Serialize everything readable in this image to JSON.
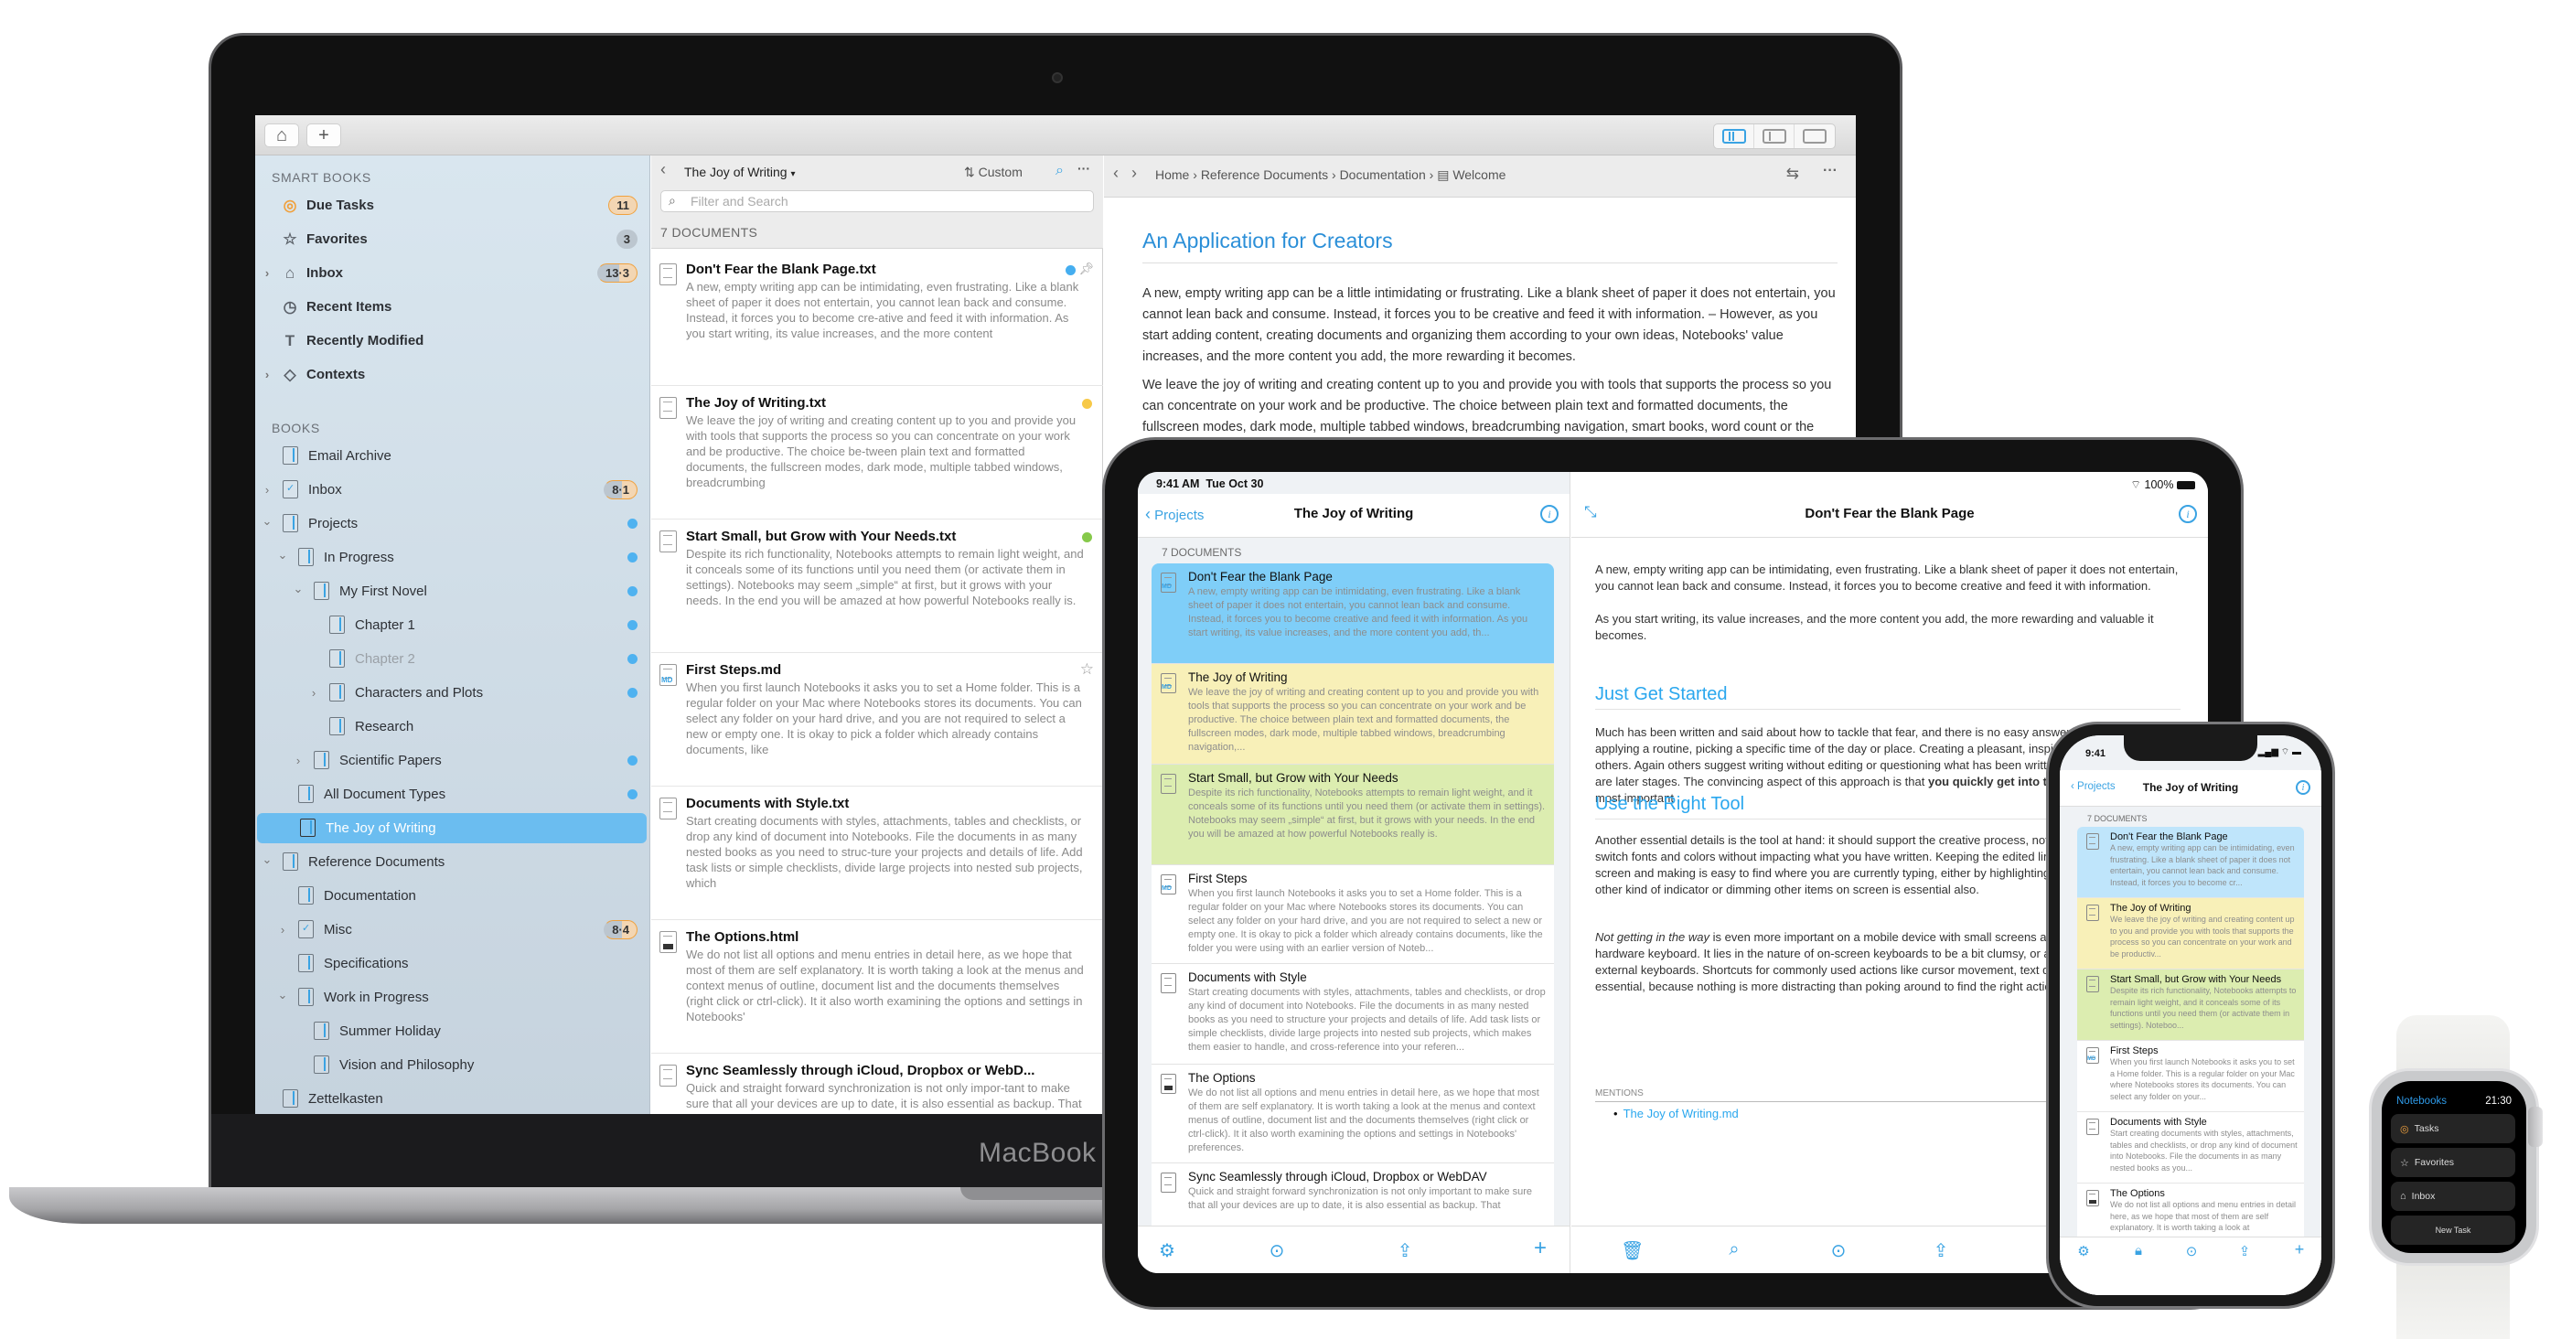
{
  "mac": {
    "brand": "MacBook Pro",
    "toolbar": {
      "home_icon": "home-icon",
      "add_icon": "plus-icon",
      "view_modes": [
        "three-pane",
        "two-pane",
        "single-pane"
      ]
    },
    "sidebar": {
      "smart_books_header": "SMART BOOKS",
      "smart_books": [
        {
          "label": "Due Tasks",
          "icon": "checkmark-circle-icon",
          "badge": "11",
          "badge_style": "orange"
        },
        {
          "label": "Favorites",
          "icon": "star-icon",
          "badge": "3",
          "badge_style": "gray"
        },
        {
          "label": "Inbox",
          "icon": "inbox-tray-icon",
          "badge": "13·3",
          "badge_style": "mixed",
          "expandable": true
        },
        {
          "label": "Recent Items",
          "icon": "clock-icon"
        },
        {
          "label": "Recently Modified",
          "icon": "text-cursor-icon"
        },
        {
          "label": "Contexts",
          "icon": "tag-icon",
          "expandable": true
        }
      ],
      "books_header": "BOOKS",
      "books": [
        {
          "label": "Email Archive",
          "depth": 0
        },
        {
          "label": "Inbox",
          "depth": 0,
          "badge": "8·1",
          "badge_style": "mixed",
          "expandable": true,
          "task": true
        },
        {
          "label": "Projects",
          "depth": 0,
          "dot": true,
          "expanded": true
        },
        {
          "label": "In Progress",
          "depth": 1,
          "dot": true,
          "expanded": true
        },
        {
          "label": "My First Novel",
          "depth": 2,
          "dot": true,
          "expanded": true
        },
        {
          "label": "Chapter 1",
          "depth": 3,
          "dot": true
        },
        {
          "label": "Chapter 2",
          "depth": 3,
          "dot": true,
          "dim": true
        },
        {
          "label": "Characters and Plots",
          "depth": 3,
          "dot": true,
          "expandable": true
        },
        {
          "label": "Research",
          "depth": 3
        },
        {
          "label": "Scientific Papers",
          "depth": 2,
          "dot": true,
          "expandable": true
        },
        {
          "label": "All Document Types",
          "depth": 1,
          "dot": true
        },
        {
          "label": "The Joy of Writing",
          "depth": 1,
          "selected": true
        },
        {
          "label": "Reference Documents",
          "depth": 0,
          "expanded": true
        },
        {
          "label": "Documentation",
          "depth": 1
        },
        {
          "label": "Misc",
          "depth": 1,
          "badge": "8·4",
          "badge_style": "mixed",
          "expandable": true,
          "task": true
        },
        {
          "label": "Specifications",
          "depth": 1
        },
        {
          "label": "Work in Progress",
          "depth": 1,
          "expanded": true
        },
        {
          "label": "Summer Holiday",
          "depth": 2
        },
        {
          "label": "Vision and Philosophy",
          "depth": 2
        },
        {
          "label": "Zettelkasten",
          "depth": 0
        }
      ]
    },
    "list": {
      "book_title": "The Joy of Writing",
      "sort_label": "Custom",
      "search_placeholder": "Filter and Search",
      "count_label": "7 DOCUMENTS",
      "documents": [
        {
          "title": "Don't Fear the Blank Page.txt",
          "type": "txt",
          "mark": "#45aef0",
          "pinned": true,
          "snippet": "A new, empty writing app can be intimidating, even frustrating. Like a blank sheet of paper it does not entertain, you cannot lean back and consume. Instead, it forces you to become cre-ative and feed it with information. As you start writing, its value increases, and the more content"
        },
        {
          "title": "The Joy of Writing.txt",
          "type": "txt",
          "mark": "#f7c948",
          "snippet": "We leave the joy of writing and creating content up to you and provide you with tools that supports the process so you can concentrate on your work and be productive. The choice be-tween plain text and formatted documents, the fullscreen modes, dark mode, multiple tabbed windows, breadcrumbing"
        },
        {
          "title": "Start Small, but Grow with Your Needs.txt",
          "type": "txt",
          "mark": "#86c94a",
          "snippet": "Despite its rich functionality, Notebooks attempts to remain light weight, and it conceals some of its functions until you need them (or activate them in settings). Notebooks may seem „simple“ at first, but it grows with your needs. In the end you will be amazed at how powerful Notebooks really is."
        },
        {
          "title": "First Steps.md",
          "type": "md",
          "starred": true,
          "snippet": "When you first launch Notebooks it asks you to set a Home folder. This is a regular folder on your Mac where Notebooks stores its documents. You can select any folder on your hard drive, and you are not required to select a new or empty one. It is okay to pick a folder which already contains documents, like"
        },
        {
          "title": "Documents with Style.txt",
          "type": "txt",
          "snippet": "Start creating documents with styles, attachments, tables and checklists, or drop any kind of document into Notebooks. File the documents in as many nested books as you need to struc-ture your projects and details of life. Add task lists or simple checklists, divide large projects into nested sub projects, which"
        },
        {
          "title": "The Options.html",
          "type": "html",
          "snippet": "We do not list all options and menu entries in detail here, as we hope that most of them are self explanatory. It is worth taking a look at the menus and context menus of outline, document list and the documents themselves (right click or ctrl-click). It it also worth examining the options and settings in Notebooks'"
        },
        {
          "title": "Sync Seamlessly through iCloud, Dropbox or WebD...",
          "type": "txt",
          "snippet": "Quick and straight forward synchronization is not only impor-tant to make sure that all your devices are up to date, it is also essential as backup. That is why Notebooks offers several op-tions. iCloud is the natural way of synchronizing in an iOS and macOS world. Once set up–and that actually just means allow-"
        }
      ]
    },
    "editor": {
      "breadcrumbs": [
        "Home",
        "Reference Documents",
        "Documentation",
        "Welcome"
      ],
      "heading": "An Application for Creators",
      "paragraphs": [
        "A new, empty writing app can be a little intimidating or frustrating. Like a blank sheet of paper it does not entertain, you cannot lean back and consume. Instead, it forces you to be creative and feed it with information. – However, as you start adding content, creating documents and organizing them according to your own ideas, Notebooks' value increases, and the more content you add, the more rewarding it becomes.",
        "We leave the joy of writing and creating content up to you and provide you with tools that supports the process so you can concentrate on your work and be productive. The choice between plain text and formatted documents, the fullscreen modes, dark mode, multiple tabbed windows, breadcrumbing navigation, smart books, word count or the option to compile multiple fragments into a single document or eBook are just a few examples."
      ]
    }
  },
  "ipad": {
    "status_time": "9:41 AM",
    "status_date": "Tue Oct 30",
    "battery": "100%",
    "list": {
      "back_label": "Projects",
      "title": "The Joy of Writing",
      "count_label": "7 DOCUMENTS",
      "documents": [
        {
          "title": "Don't Fear the Blank Page",
          "type": "md",
          "color": "#7fcef8",
          "snippet": "A new, empty writing app can be intimidating, even frustrating. Like a blank sheet of paper it does not entertain, you cannot lean back and consume. Instead, it forces you to become creative and feed it with information. As you start writing, its value increases, and the more content you add, th..."
        },
        {
          "title": "The Joy of Writing",
          "type": "md",
          "color": "#f8f0b8",
          "snippet": "We leave the joy of writing and creating content up to you and provide you with tools that supports the process so you can concentrate on your work and be productive. The choice between plain text and formatted documents, the fullscreen modes, dark mode, multiple tabbed windows, breadcrumbing navigation,..."
        },
        {
          "title": "Start Small, but Grow with Your Needs",
          "type": "txt",
          "color": "#dcedb0",
          "snippet": "Despite its rich functionality, Notebooks attempts to remain light weight, and it conceals some of its functions until you need them (or activate them in settings). Notebooks may seem „simple“ at first, but it grows with your needs. In the end you will be amazed at how powerful Notebooks really is."
        },
        {
          "title": "First Steps",
          "type": "md",
          "color": "#ffffff",
          "snippet": "When you first launch Notebooks it asks you to set a Home folder. This is a regular folder on your Mac where Notebooks stores its documents. You can select any folder on your hard drive, and you are not required to select a new or empty one. It is okay to pick a folder which already contains documents, like the folder you were using with an earlier version of Noteb..."
        },
        {
          "title": "Documents with Style",
          "type": "txt",
          "color": "#ffffff",
          "snippet": "Start creating documents with styles, attachments, tables and checklists, or drop any kind of document into Notebooks. File the documents in as many nested books as you need to structure your projects and details of life. Add task lists or simple checklists, divide large projects into nested sub projects, which makes them easier to handle, and cross-reference into your referen..."
        },
        {
          "title": "The Options",
          "type": "html",
          "color": "#ffffff",
          "snippet": "We do not list all options and menu entries in detail here, as we hope that most of them are self explanatory. It is worth taking a look at the menus and context menus of outline, document list and the documents themselves (right click or ctrl-click). It it also worth examining the options and settings in Notebooks' preferences."
        },
        {
          "title": "Sync Seamlessly through iCloud, Dropbox or WebDAV",
          "type": "txt",
          "color": "#ffffff",
          "snippet": "Quick and straight forward synchronization is not only important to make sure that all your devices are up to date, it is also essential as backup. That"
        }
      ],
      "toolbar_icons": [
        "settings-gear-icon",
        "more-icon",
        "share-icon",
        "plus-icon"
      ]
    },
    "editor": {
      "title": "Don't Fear the Blank Page",
      "p1": "A new, empty writing app can be intimidating, even frustrating. Like a blank sheet of paper it does not entertain, you cannot lean back and consume. Instead, it forces you to become creative and feed it with information.",
      "p2": "As you start writing, its value increases, and the more content you add, the more rewarding and valuable it becomes.",
      "h2": "Just Get Started",
      "p3": "Much has been written and said about how to tackle that fear, and there is no easy answer. Staying focussed, applying a routine, picking a specific time of the day or place. Creating a pleasant, inspiring environment helps others. Again others suggest writing without editing or questioning what has been written; editing and formatting are later stages. The convincing aspect of this approach is that",
      "p3_bold": "you quickly get into the flow of writing",
      "p3_end": ", which is most important .",
      "h3": "Use the Right Tool",
      "p4": "Another essential details is the tool at hand: it should support the creative process, not get in the way. Adjust or switch fonts and colors without impacting what you have written. Keeping the edited line in the same position on screen and making is easy to find where you are currently typing, either by highlighting the line or adding some other kind of indicator or dimming other items on screen is essential also.",
      "p5_italic": "Not getting in the way",
      "p5": " is even more important on a mobile device with small screens and without a dedicated hardware keyboard. It lies in the nature of on-screen keyboards to be a bit clumsy, or at least slower to use than external keyboards. Shortcuts for commonly used actions like cursor movement, text deletion or arrangement are essential, because nothing is more distracting than poking around to find the right actions.",
      "mentions_label": "MENTIONS",
      "mention_link": "The Joy of Writing.md",
      "toolbar_icons": [
        "trash-icon",
        "search-icon",
        "more-icon",
        "share-icon"
      ]
    }
  },
  "iphone": {
    "status_time": "9:41",
    "back_label": "Projects",
    "title": "The Joy of Writing",
    "count_label": "7 DOCUMENTS",
    "documents": [
      {
        "title": "Don't Fear the Blank Page",
        "type": "txt",
        "color": "#bfe5fb",
        "snippet": "A new, empty writing app can be intimidating, even frustrating. Like a blank sheet of paper it does not entertain, you cannot lean back and consume. Instead, it forces you to become cr..."
      },
      {
        "title": "The Joy of Writing",
        "type": "txt",
        "color": "#f8f0b8",
        "snippet": "We leave the joy of writing and creating content up to you and provide you with tools that supports the process so you can concentrate on your work and be productiv..."
      },
      {
        "title": "Start Small, but Grow with Your Needs",
        "type": "txt",
        "color": "#dcedb0",
        "snippet": "Despite its rich functionality, Notebooks attempts to remain light weight, and it conceals some of its functions until you need them (or activate them in settings). Noteboo..."
      },
      {
        "title": "First Steps",
        "type": "md",
        "color": "#ffffff",
        "snippet": "When you first launch Notebooks it asks you to set a Home folder. This is a regular folder on your Mac where Notebooks stores its documents. You can select any folder on your..."
      },
      {
        "title": "Documents with Style",
        "type": "txt",
        "color": "#ffffff",
        "snippet": "Start creating documents with styles, attachments, tables and checklists, or drop any kind of document into Notebooks. File the documents in as many nested books as you..."
      },
      {
        "title": "The Options",
        "type": "html",
        "color": "#ffffff",
        "snippet": "We do not list all options and menu entries in detail here, as we hope that most of them are self explanatory. It is worth taking a look at"
      }
    ],
    "toolbar_icons": [
      "settings-gear-icon",
      "lock-icon",
      "more-icon",
      "share-icon",
      "plus-icon"
    ]
  },
  "watch": {
    "app_name": "Notebooks",
    "time": "21:30",
    "items": [
      {
        "label": "Tasks",
        "icon": "checkmark-circle-icon"
      },
      {
        "label": "Favorites",
        "icon": "star-icon"
      },
      {
        "label": "Inbox",
        "icon": "inbox-tray-icon"
      }
    ],
    "new_task_label": "New Task"
  },
  "colors": {
    "accent": "#3aa3e3",
    "selection": "#6bbdf0",
    "heading": "#2b8fd8",
    "task_orange": "#f0a13e"
  }
}
